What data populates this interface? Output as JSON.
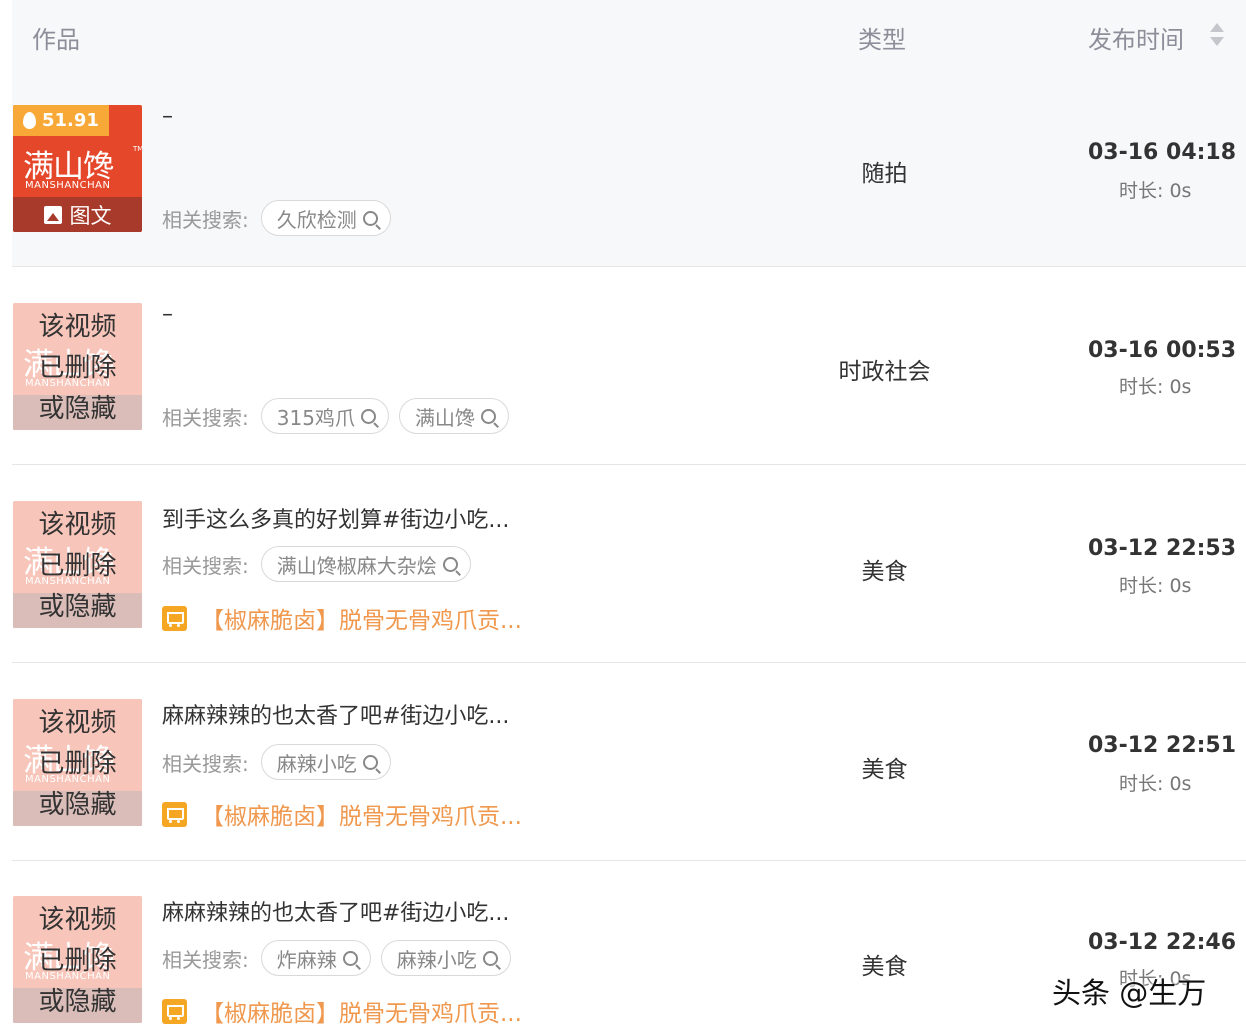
{
  "header": {
    "col_work": "作品",
    "col_type": "类型",
    "col_time": "发布时间"
  },
  "search_label": "相关搜索:",
  "thumb": {
    "logo_cn": "满山馋",
    "logo_en": "MANSHANCHAN",
    "tm": "TM",
    "heat": "51.91",
    "image_text_label": "图文",
    "deleted_text": [
      "该视频",
      "已删除",
      "或隐藏"
    ]
  },
  "rows": [
    {
      "title": "–",
      "searches": [
        "久欣检测"
      ],
      "product": "",
      "type": "随拍",
      "date": "03-16 04:18",
      "duration": "时长: 0s"
    },
    {
      "title": "–",
      "searches": [
        "315鸡爪",
        "满山馋"
      ],
      "product": "",
      "type": "时政社会",
      "date": "03-16 00:53",
      "duration": "时长: 0s"
    },
    {
      "title": "到手这么多真的好划算#街边小吃...",
      "searches": [
        "满山馋椒麻大杂烩"
      ],
      "product": "【椒麻脆卤】脱骨无骨鸡爪贡...",
      "type": "美食",
      "date": "03-12 22:53",
      "duration": "时长: 0s"
    },
    {
      "title": "麻麻辣辣的也太香了吧#街边小吃...",
      "searches": [
        "麻辣小吃"
      ],
      "product": "【椒麻脆卤】脱骨无骨鸡爪贡...",
      "type": "美食",
      "date": "03-12 22:51",
      "duration": "时长: 0s"
    },
    {
      "title": "麻麻辣辣的也太香了吧#街边小吃...",
      "searches": [
        "炸麻辣",
        "麻辣小吃"
      ],
      "product": "【椒麻脆卤】脱骨无骨鸡爪贡...",
      "type": "美食",
      "date": "03-12 22:46",
      "duration": "时长: 0s"
    }
  ],
  "watermark": "头条 @生万",
  "colors": {
    "brand_red": "#e5472b",
    "heat_orange": "#f8a836",
    "product_orange": "#f0984e",
    "header_bg": "#f7f8fa"
  },
  "icons": [
    "flame-icon",
    "image-icon",
    "search-icon",
    "cart-icon",
    "sort-icon"
  ]
}
